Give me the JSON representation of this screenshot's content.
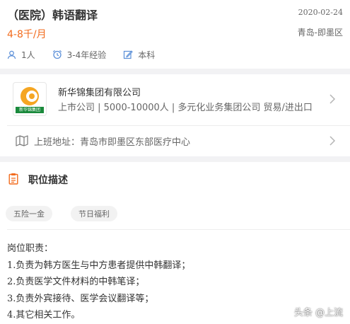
{
  "job": {
    "title": "（医院）韩语翻译",
    "post_date": "2020-02-24",
    "salary": "4-8千/月",
    "location": "青岛-即墨区",
    "requirements": [
      {
        "icon": "person-icon",
        "label": "1人"
      },
      {
        "icon": "alarm-clock-icon",
        "label": "3-4年经验"
      },
      {
        "icon": "pencil-icon",
        "label": "本科"
      }
    ]
  },
  "company": {
    "logo_text": "新华锦集团",
    "name": "新华锦集团有限公司",
    "meta": "上市公司 | 5000-10000人 | 多元化业务集团公司 贸易/进出口",
    "address": "上班地址：青岛市即墨区东部医疗中心"
  },
  "description": {
    "section_title": "职位描述",
    "tags": [
      "五险一金",
      "节日福利"
    ],
    "lines": [
      "岗位职责：",
      "1.负责为韩方医生与中方患者提供中韩翻译；",
      "2.负责医学文件材料的中韩笔译；",
      "3.负责外宾接待、医学会议翻译等；",
      "4.其它相关工作。"
    ]
  },
  "watermark": "头条 @上流",
  "colors": {
    "accent": "#f26b1d",
    "icon_blue": "#5b8fd8",
    "logo_orange": "#f5a623",
    "logo_green": "#1a8a3c"
  }
}
